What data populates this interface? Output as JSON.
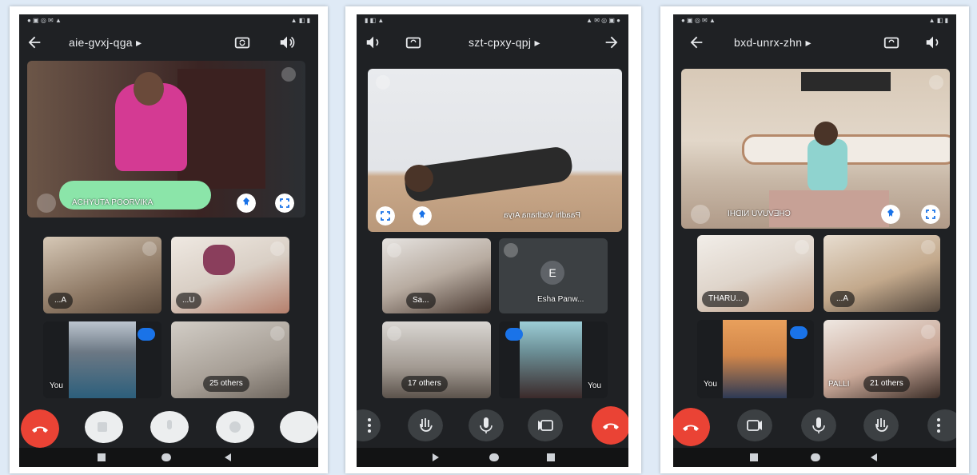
{
  "colors": {
    "accent_blue": "#1a73e8",
    "end_call": "#ea4335",
    "phone_bg": "#1f2124"
  },
  "phones": [
    {
      "meeting_code": "aie-gvxj-qga ▸",
      "pinned_name": "ACHYUTA POORVIKA",
      "tiles": [
        {
          "label": "...A"
        },
        {
          "label": "...U"
        },
        {
          "label": "You"
        },
        {
          "label": "25 others"
        }
      ],
      "icons": [
        "back-arrow-icon",
        "switch-camera-icon",
        "speaker-icon",
        "pin-icon",
        "fullscreen-icon",
        "end-call-icon",
        "camera-icon",
        "mic-icon",
        "raise-hand-icon",
        "more-icon"
      ]
    },
    {
      "meeting_code": "szt-cpxy-qpj ▸",
      "pinned_name": "Paadhi Vadhana Arya",
      "tiles": [
        {
          "label": "Sa..."
        },
        {
          "label": "Esha Panw...",
          "avatar_letter": "E"
        },
        {
          "label": "17 others"
        },
        {
          "label": "You"
        }
      ],
      "icons": [
        "speaker-icon",
        "switch-camera-icon",
        "back-arrow-icon",
        "fullscreen-icon",
        "pin-icon",
        "more-icon",
        "raise-hand-icon",
        "mic-icon",
        "camera-icon",
        "end-call-icon"
      ]
    },
    {
      "meeting_code": "bxd-unrx-zhn ▸",
      "pinned_name": "CHEVUVU NIDHI",
      "tiles": [
        {
          "label": "THARU..."
        },
        {
          "label": "...A"
        },
        {
          "label": "You"
        },
        {
          "label": "21 others",
          "side": "PALLI"
        }
      ],
      "icons": [
        "back-arrow-icon",
        "switch-camera-icon",
        "speaker-icon",
        "pin-icon",
        "fullscreen-icon",
        "end-call-icon",
        "camera-icon",
        "mic-icon",
        "raise-hand-icon",
        "more-icon"
      ]
    }
  ]
}
